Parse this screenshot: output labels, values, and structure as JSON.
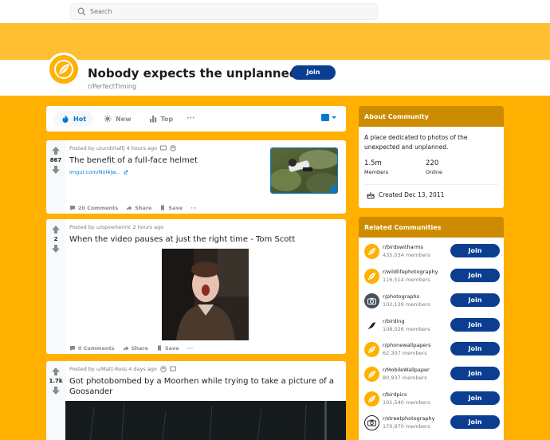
{
  "search": {
    "placeholder": "Search"
  },
  "community": {
    "title": "Nobody expects the unplanned",
    "name": "r/PerfectTiming",
    "join_label": "Join",
    "accent": "#ffb000"
  },
  "sort": {
    "tabs": [
      {
        "label": "Hot",
        "active": true
      },
      {
        "label": "New",
        "active": false
      },
      {
        "label": "Top",
        "active": false
      }
    ],
    "more": "···"
  },
  "posts": [
    {
      "votes": "867",
      "meta": "Posted by u/undirtalfj 4 hours ago",
      "title": "The benefit of a full-face helmet",
      "link": "imgur.com/Nol4jw...",
      "comments": "20 Comments",
      "share": "Share",
      "save": "Save",
      "more": "···"
    },
    {
      "votes": "2",
      "meta": "Posted by u/opvertenric 2 hours ago",
      "title": "When the video pauses at just the right time - Tom Scott",
      "comments": "0 Comments",
      "share": "Share",
      "save": "Save",
      "more": "···"
    },
    {
      "votes": "1.7k",
      "meta": "Posted by u/Matt-Ross 4 days ago",
      "title": "Got photobombed by a Moorhen while trying to take a picture of a Goosander"
    }
  ],
  "about": {
    "heading": "About Community",
    "description": "A place dedicated to photos of the unexpected and unplanned.",
    "members_value": "1.5m",
    "members_label": "Members",
    "online_value": "220",
    "online_label": "Online",
    "created": "Created Dec 13, 2011"
  },
  "related": {
    "heading": "Related Communities",
    "join_label": "Join",
    "items": [
      {
        "name": "r/birdswitharms",
        "members": "435,034 members",
        "icon": "leaf-icon"
      },
      {
        "name": "r/wildlifephotography",
        "members": "116,514 members",
        "icon": "leaf-icon"
      },
      {
        "name": "r/photographs",
        "members": "102,139 members",
        "icon": "camera-icon"
      },
      {
        "name": "r/birding",
        "members": "108,026 members",
        "icon": "bird-icon"
      },
      {
        "name": "r/phonewallpapers",
        "members": "62,307 members",
        "icon": "leaf-icon"
      },
      {
        "name": "r/MobileWallpaper",
        "members": "80,937 members",
        "icon": "leaf-icon"
      },
      {
        "name": "r/birdpics",
        "members": "101,540 members",
        "icon": "leaf-icon"
      },
      {
        "name": "r/streetphotography",
        "members": "170,970 members",
        "icon": "street-camera-icon"
      }
    ]
  }
}
